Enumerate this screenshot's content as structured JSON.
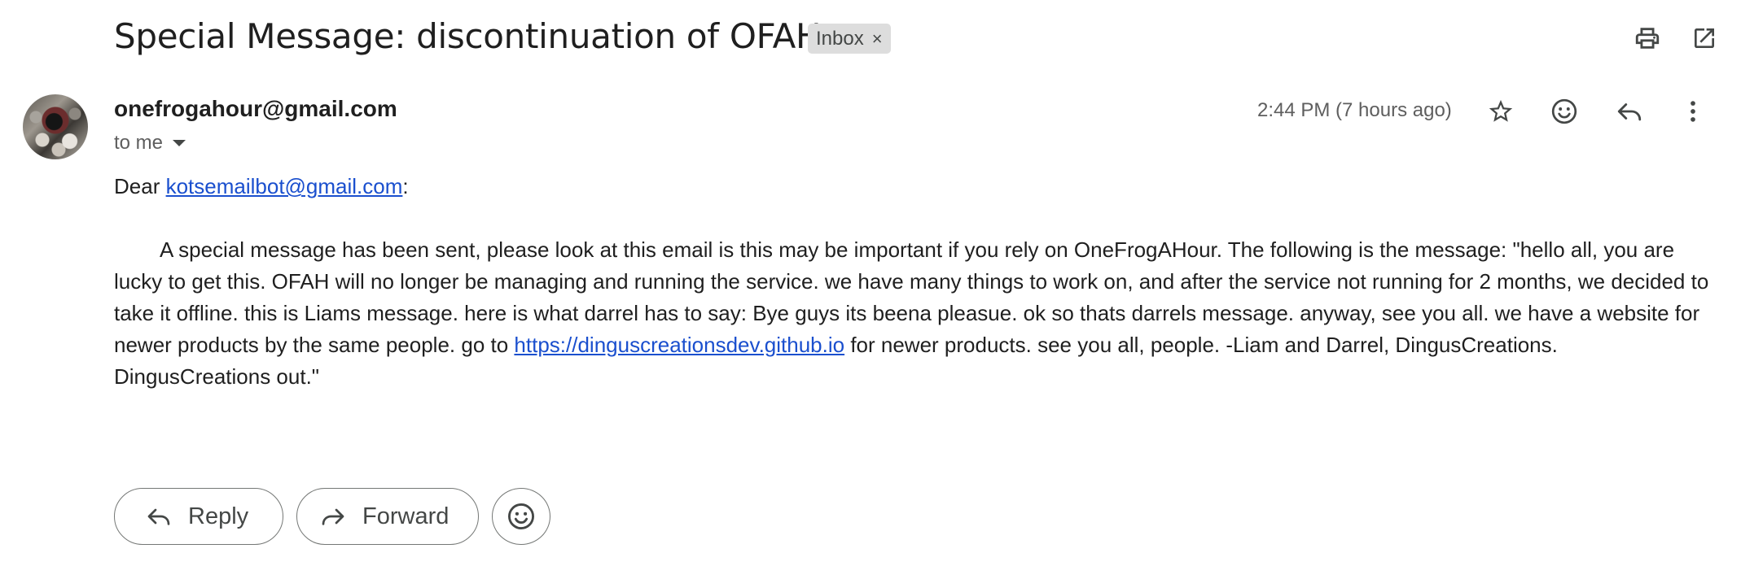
{
  "email": {
    "subject": "Special Message: discontinuation of OFAH",
    "label": "Inbox",
    "label_remove": "×",
    "sender": "onefrogahour@gmail.com",
    "recipient": "to me",
    "timestamp": "2:44 PM (7 hours ago)",
    "greeting_prefix": "Dear ",
    "greeting_email": "kotsemailbot@gmail.com",
    "greeting_suffix": ":",
    "body_part1": "A special message has been sent, please look at this email is this may be important if you rely on OneFrogAHour. The following is the message: \"hello all, you are lucky to get this. OFAH will no longer be managing and running the service. we have many things to work on, and after the service not running for 2 months, we decided to take it offline. this is Liams message. here is what darrel has to say: Bye guys its beena pleasue. ok so thats darrels message. anyway, see you all. we have a website for newer products by the same people. go to ",
    "body_link": "https://dinguscreationsdev.github.io",
    "body_part2": " for newer products. see you all, people. -Liam and Darrel, DingusCreations. DingusCreations out.\""
  },
  "actions": {
    "reply_label": "Reply",
    "forward_label": "Forward"
  },
  "icons": {
    "top": [
      "print-icon",
      "open-in-new-window-icon"
    ],
    "header": [
      "star-icon",
      "emoji-reaction-icon",
      "reply-icon",
      "more-vert-icon"
    ],
    "bottom": [
      "reply-icon",
      "forward-icon",
      "emoji-reaction-icon"
    ]
  },
  "colors": {
    "link": "#1a4fce",
    "label_chip_bg": "#dddddd",
    "text_primary": "#1f1f1f",
    "text_secondary": "#5e5e5e"
  }
}
